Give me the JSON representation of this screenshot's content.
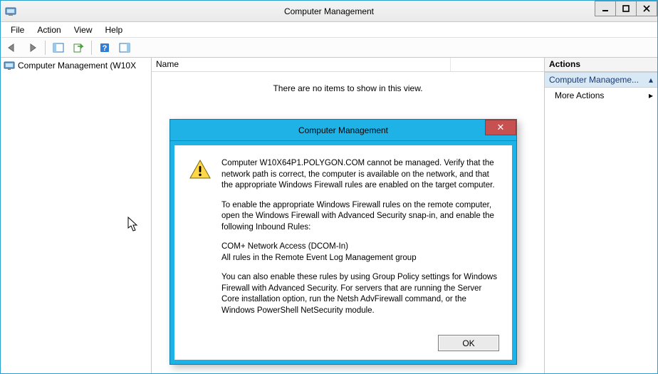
{
  "window": {
    "title": "Computer Management"
  },
  "menu": {
    "file": "File",
    "action": "Action",
    "view": "View",
    "help": "Help"
  },
  "tree": {
    "root_label": "Computer Management (W10X"
  },
  "list": {
    "col_name": "Name",
    "empty_msg": "There are no items to show in this view."
  },
  "actions": {
    "header": "Actions",
    "group_label": "Computer Manageme...",
    "more_label": "More Actions"
  },
  "dialog": {
    "title": "Computer Management",
    "p1": "Computer W10X64P1.POLYGON.COM cannot be managed. Verify that the network path is correct, the computer is available on the network, and that the appropriate Windows Firewall rules are enabled on the target computer.",
    "p2": "To enable the appropriate Windows Firewall rules on the remote computer, open the Windows Firewall with Advanced Security snap-in, and enable the following Inbound Rules:",
    "p3": "COM+ Network Access (DCOM-In)\nAll rules in the Remote Event Log Management group",
    "p4": "You can also enable these rules by using Group Policy settings for Windows Firewall with Advanced Security. For servers that are running the Server Core installation option, run the Netsh AdvFirewall command, or the Windows PowerShell NetSecurity module.",
    "ok": "OK"
  },
  "glyphs": {
    "close_x": "✕",
    "triangle_up": "▴",
    "triangle_right": "▸"
  }
}
